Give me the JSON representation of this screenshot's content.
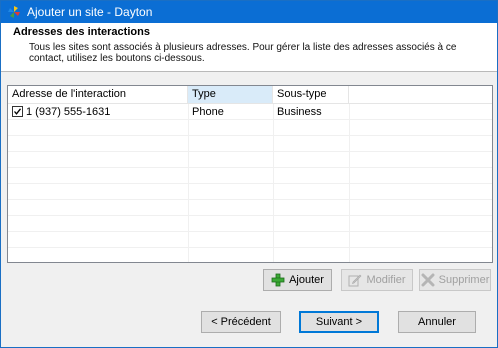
{
  "window": {
    "title": "Ajouter un site - Dayton",
    "app_icon": "colorful-pinwheel-icon"
  },
  "header": {
    "title": "Adresses des interactions",
    "description": "Tous les sites sont associés à plusieurs adresses. Pour gérer la liste des adresses associés à ce contact, utilisez les boutons ci-dessous."
  },
  "grid": {
    "columns": [
      {
        "label": "Adresse de l'interaction",
        "sorted": false
      },
      {
        "label": "Type",
        "sorted": true
      },
      {
        "label": "Sous-type",
        "sorted": false
      }
    ],
    "rows": [
      {
        "checked": true,
        "address": "1 (937) 555-1631",
        "type": "Phone",
        "subtype": "Business"
      }
    ]
  },
  "actions": {
    "add_label": "Ajouter",
    "add_icon": "green-plus-icon",
    "edit_label": "Modifier",
    "edit_icon": "edit-pencil-icon",
    "delete_label": "Supprimer",
    "delete_icon": "delete-x-icon"
  },
  "footer": {
    "previous_label": "< Précédent",
    "next_label": "Suivant >",
    "cancel_label": "Annuler"
  },
  "colors": {
    "titlebar": "#0b6ed4",
    "sorted_column": "#d9ebf9",
    "default_button_border": "#0078d7"
  }
}
